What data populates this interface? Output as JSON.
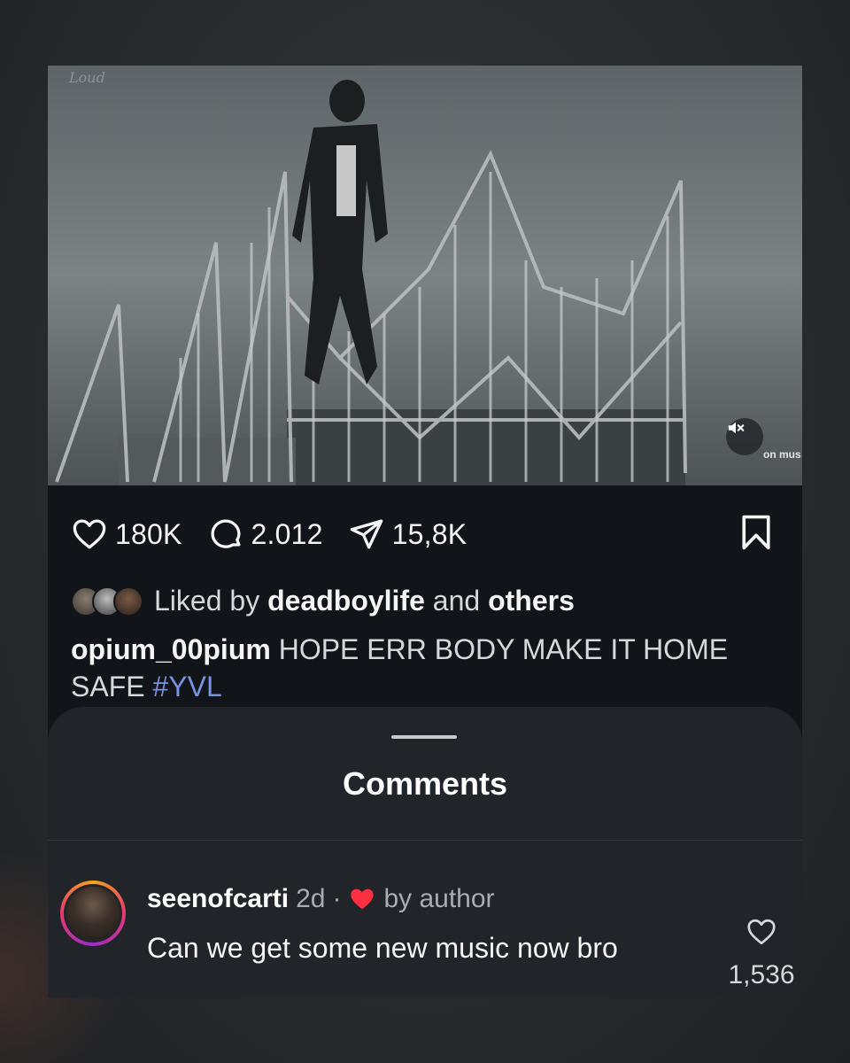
{
  "media": {
    "watermark": "Loud",
    "mute_icon": "speaker-muted-icon",
    "brand_text": "on mus"
  },
  "actions": {
    "likes_count": "180K",
    "comments_count": "2.012",
    "shares_count": "15,8K",
    "icons": [
      "heart-icon",
      "comment-bubble-icon",
      "send-icon",
      "bookmark-icon"
    ]
  },
  "liked_by": {
    "prefix": "Liked by",
    "user": "deadboylife",
    "joiner": "and",
    "others": "others"
  },
  "caption": {
    "username": "opium_00pium",
    "text": "HOPE ERR BODY MAKE IT HOME SAFE",
    "hashtag": "#YVL"
  },
  "comments_sheet": {
    "title": "Comments",
    "comments": [
      {
        "username": "seenofcarti",
        "time": "2d",
        "separator": "·",
        "liked_by_author": "by author",
        "text": "Can we get some new music now bro",
        "like_count": "1,536"
      }
    ]
  },
  "colors": {
    "background": "#2b2e31",
    "card": "#111418",
    "sheet": "#212428",
    "hashtag": "#7a93e0",
    "author_heart": "#ff3040"
  }
}
